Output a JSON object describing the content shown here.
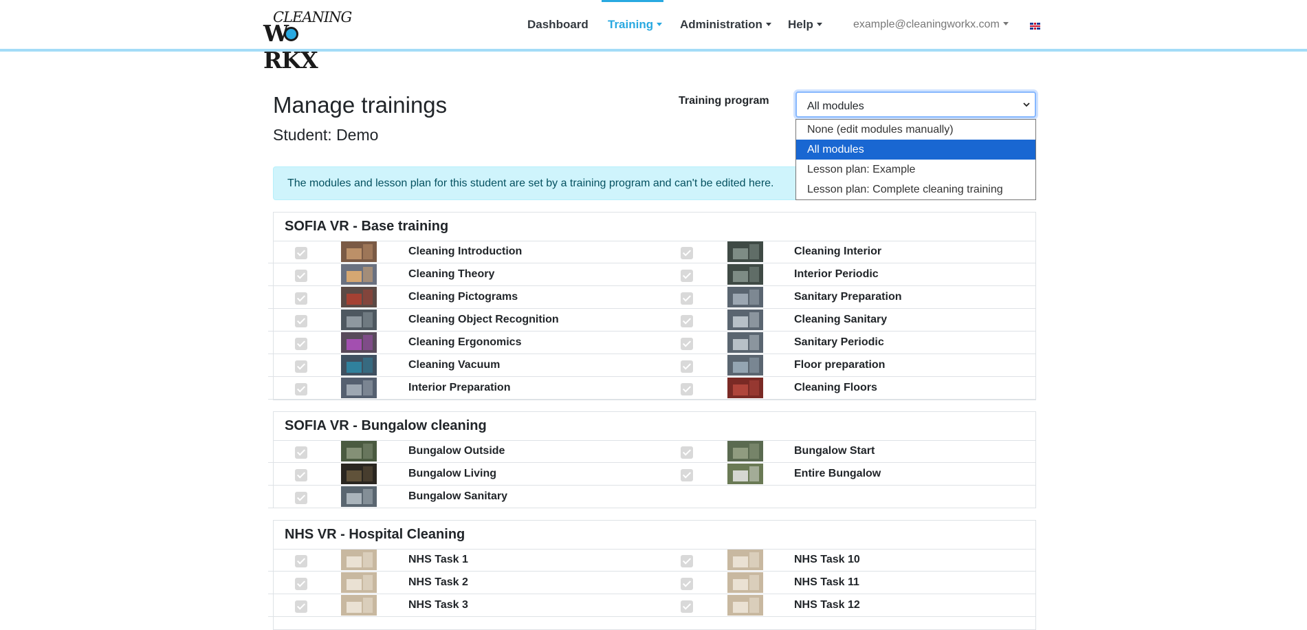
{
  "nav": {
    "logo_top": "CLEANING",
    "logo_bottom": "W  RKX",
    "items": [
      {
        "label": "Dashboard"
      },
      {
        "label": "Training"
      },
      {
        "label": "Administration"
      },
      {
        "label": "Help"
      }
    ],
    "user": "example@cleaningworkx.com",
    "language_icon": "uk-flag-icon",
    "accent_color": "#29a9e1"
  },
  "header": {
    "title": "Manage trainings",
    "student": "Student: Demo"
  },
  "program": {
    "label": "Training program",
    "selected": "All modules",
    "options": [
      "None (edit modules manually)",
      "All modules",
      "Lesson plan: Example",
      "Lesson plan: Complete cleaning training"
    ]
  },
  "alert": "The modules and lesson plan for this student are set by a training program and can't be edited here.",
  "groups": [
    {
      "title": "SOFIA VR - Base training",
      "left": [
        "Cleaning Introduction",
        "Cleaning Theory",
        "Cleaning Pictograms",
        "Cleaning Object Recognition",
        "Cleaning Ergonomics",
        "Cleaning Vacuum",
        "Interior Preparation"
      ],
      "right": [
        "Cleaning Interior",
        "Interior Periodic",
        "Sanitary Preparation",
        "Cleaning Sanitary",
        "Sanitary Periodic",
        "Floor preparation",
        "Cleaning Floors"
      ]
    },
    {
      "title": "SOFIA VR - Bungalow cleaning",
      "left": [
        "Bungalow Outside",
        "Bungalow Living",
        "Bungalow Sanitary"
      ],
      "right": [
        "Bungalow Start",
        "Entire Bungalow"
      ]
    },
    {
      "title": "NHS VR - Hospital Cleaning",
      "left": [
        "NHS Task 1",
        "NHS Task 2",
        "NHS Task 3"
      ],
      "right": [
        "NHS Task 10",
        "NHS Task 11",
        "NHS Task 12"
      ]
    }
  ]
}
